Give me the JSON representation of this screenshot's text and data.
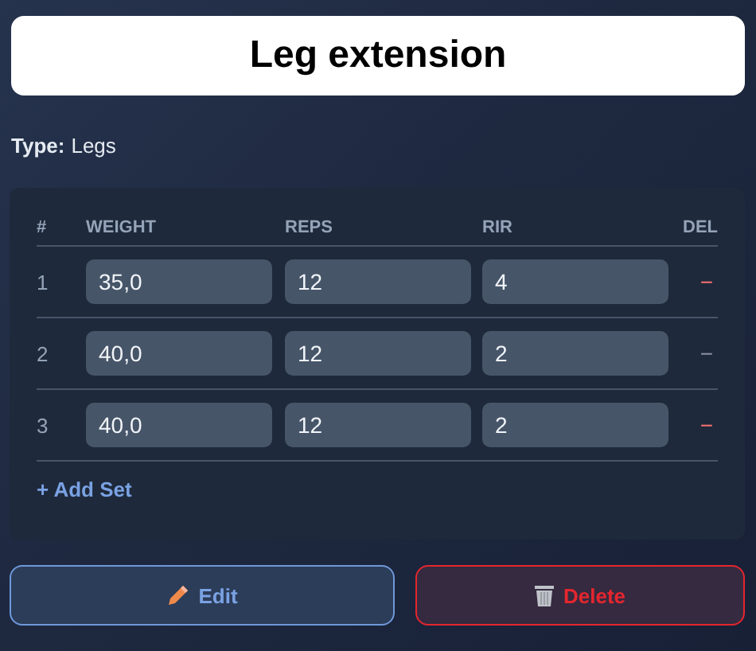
{
  "title": "Leg extension",
  "type": {
    "label": "Type:",
    "value": "Legs"
  },
  "table": {
    "columns": [
      "#",
      "WEIGHT",
      "REPS",
      "RIR",
      "DEL"
    ],
    "rows": [
      {
        "index": "1",
        "weight": "35,0",
        "reps": "12",
        "rir": "4",
        "delete": "−",
        "dimmed": false
      },
      {
        "index": "2",
        "weight": "40,0",
        "reps": "12",
        "rir": "2",
        "delete": "−",
        "dimmed": true
      },
      {
        "index": "3",
        "weight": "40,0",
        "reps": "12",
        "rir": "2",
        "delete": "−",
        "dimmed": false
      }
    ]
  },
  "add_set": "+ Add Set",
  "buttons": [
    {
      "kind": "edit",
      "label": "Edit"
    },
    {
      "kind": "delete",
      "label": "Delete"
    }
  ]
}
